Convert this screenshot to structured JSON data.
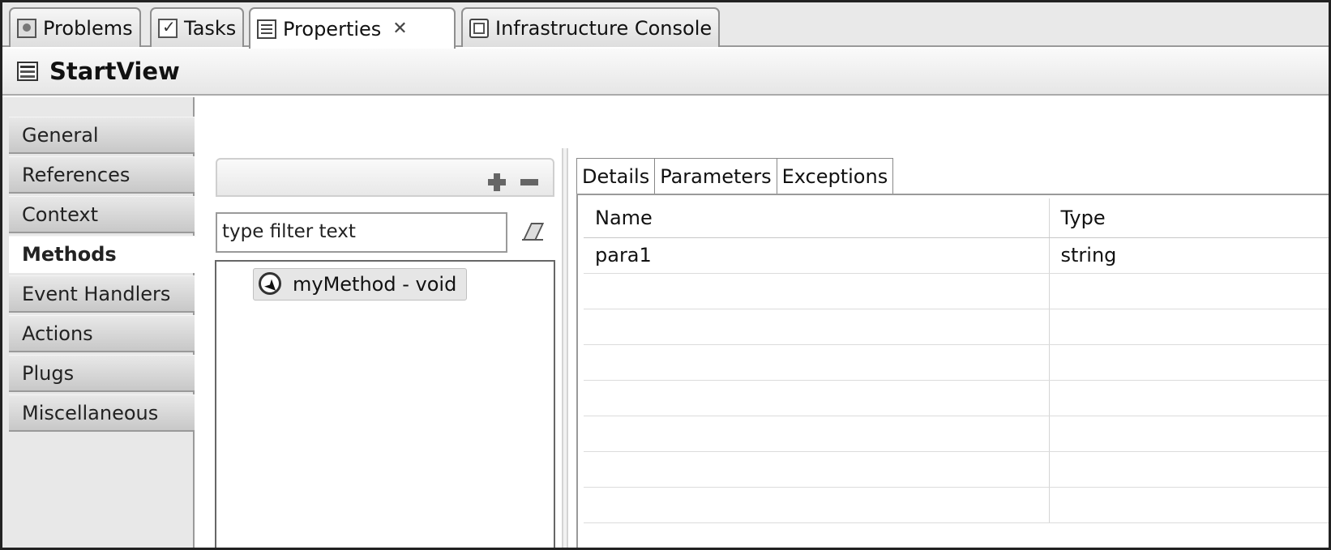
{
  "tabs": [
    {
      "label": "Problems",
      "icon": "problems-icon"
    },
    {
      "label": "Tasks",
      "icon": "tasks-icon"
    },
    {
      "label": "Properties",
      "icon": "properties-icon",
      "active": true
    },
    {
      "label": "Infrastructure Console",
      "icon": "console-icon"
    }
  ],
  "tab_close_glyph": "✕",
  "header": {
    "title": "StartView",
    "icon": "view-icon"
  },
  "nav": {
    "items": [
      "General",
      "References",
      "Context",
      "Methods",
      "Event Handlers",
      "Actions",
      "Plugs",
      "Miscellaneous"
    ],
    "selected": "Methods"
  },
  "methods": {
    "filter_placeholder": "type filter text",
    "items": [
      {
        "label": "myMethod - void",
        "icon": "method-icon"
      }
    ]
  },
  "detail_tabs": [
    "Details",
    "Parameters",
    "Exceptions"
  ],
  "detail_active_tab": "Parameters",
  "parameters": {
    "columns": [
      "Name",
      "Type"
    ],
    "rows": [
      [
        "para1",
        "string"
      ],
      [
        "",
        ""
      ],
      [
        "",
        ""
      ],
      [
        "",
        ""
      ],
      [
        "",
        ""
      ],
      [
        "",
        ""
      ],
      [
        "",
        ""
      ],
      [
        "",
        ""
      ]
    ]
  }
}
